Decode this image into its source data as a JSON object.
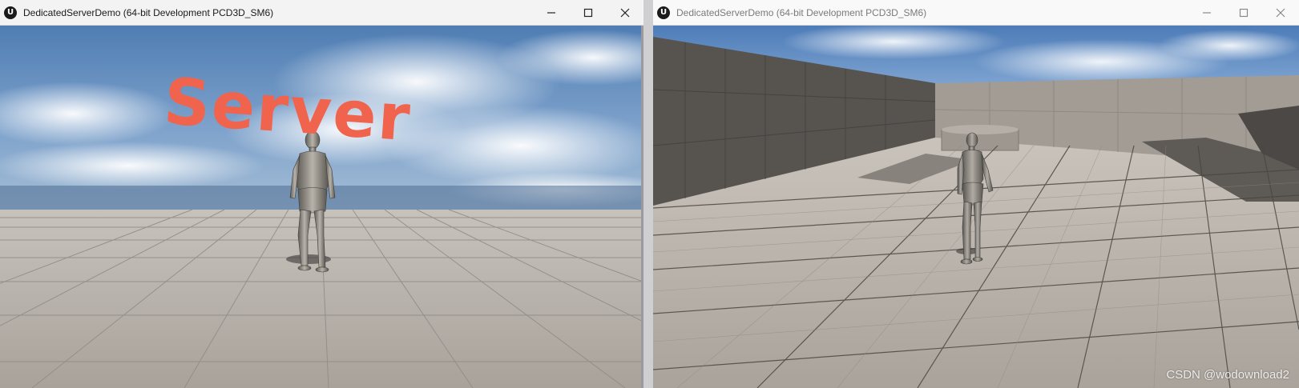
{
  "windows": [
    {
      "title": "DedicatedServerDemo (64-bit Development PCD3D_SM6)",
      "logo": "U",
      "overlay_text": "Server",
      "active": true,
      "caption_icons": [
        "minimize-icon",
        "maximize-icon",
        "close-icon"
      ]
    },
    {
      "title": "DedicatedServerDemo (64-bit Development PCD3D_SM6)",
      "logo": "U",
      "active": false,
      "caption_icons": [
        "minimize-icon",
        "maximize-icon",
        "close-icon"
      ]
    }
  ],
  "watermark": "CSDN @wodownload2",
  "colors": {
    "titlebar_active": "#f3f3f3",
    "titlebar_inactive": "#f9f9f9",
    "server_text": "#f0644e",
    "sky": "#5a85b6",
    "floor": "#b9b3ac"
  }
}
